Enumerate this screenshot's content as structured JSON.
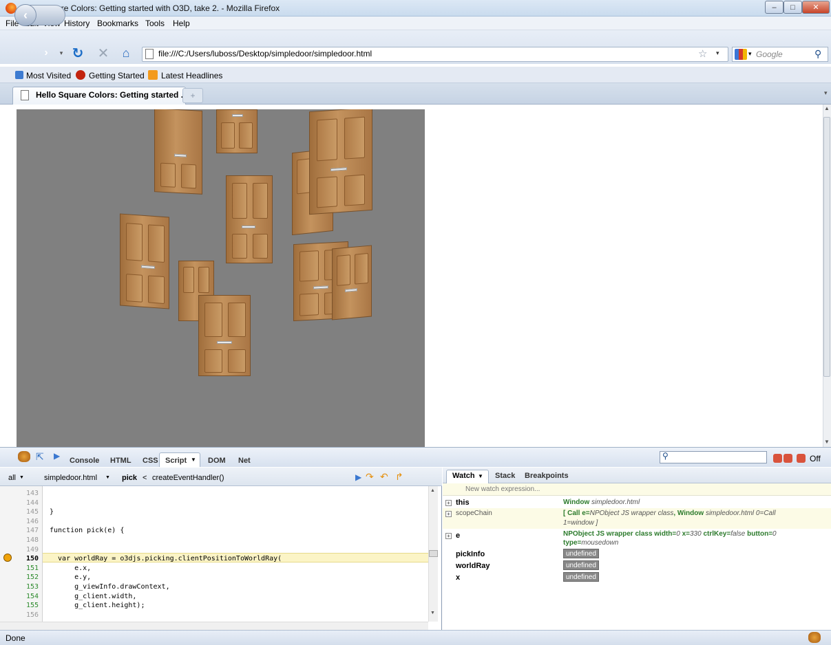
{
  "window": {
    "title": "Hello Square Colors: Getting started with O3D, take 2. - Mozilla Firefox"
  },
  "menu": [
    "File",
    "Edit",
    "View",
    "History",
    "Bookmarks",
    "Tools",
    "Help"
  ],
  "navbar": {
    "url": "file:///C:/Users/luboss/Desktop/simpledoor/simpledoor.html",
    "search_placeholder": "Google"
  },
  "bookmarks": [
    {
      "label": "Most Visited",
      "icon": "globe-icon"
    },
    {
      "label": "Getting Started",
      "icon": "firefox-icon"
    },
    {
      "label": "Latest Headlines",
      "icon": "rss-icon"
    }
  ],
  "tabs": {
    "active_label": "Hello Square Colors: Getting started ...",
    "new_tab_glyph": "+"
  },
  "firebug": {
    "panels": [
      "Console",
      "HTML",
      "CSS",
      "Script",
      "DOM",
      "Net"
    ],
    "active_panel": "Script",
    "off_label": "Off",
    "scriptbar": {
      "scope": "all",
      "file": "simpledoor.html",
      "function": "pick",
      "separator": "<",
      "caller": "createEventHandler()"
    },
    "code_lines": [
      {
        "num": "143",
        "text": "",
        "executable": false
      },
      {
        "num": "144",
        "text": "",
        "executable": false
      },
      {
        "num": "145",
        "text": "}",
        "executable": false
      },
      {
        "num": "146",
        "text": "",
        "executable": false
      },
      {
        "num": "147",
        "text": "function pick(e) {",
        "executable": false
      },
      {
        "num": "148",
        "text": "",
        "executable": false
      },
      {
        "num": "149",
        "text": "",
        "executable": false
      },
      {
        "num": "150",
        "text": "  var worldRay = o3djs.picking.clientPositionToWorldRay(",
        "executable": true,
        "current": true
      },
      {
        "num": "151",
        "text": "      e.x,",
        "executable": true
      },
      {
        "num": "152",
        "text": "      e.y,",
        "executable": true
      },
      {
        "num": "153",
        "text": "      g_viewInfo.drawContext,",
        "executable": true
      },
      {
        "num": "154",
        "text": "      g_client.width,",
        "executable": true
      },
      {
        "num": "155",
        "text": "      g_client.height);",
        "executable": true
      },
      {
        "num": "156",
        "text": "",
        "executable": false
      }
    ],
    "watch": {
      "tabs": [
        "Watch",
        "Stack",
        "Breakpoints"
      ],
      "new_expression": "New watch expression...",
      "rows": [
        {
          "name": "this",
          "value_type": "Window",
          "value_detail": "simpledoor.html"
        },
        {
          "name": "scopeChain",
          "value_line1_a": "[ Call e=",
          "value_line1_b": "NPObject JS wrapper class",
          "value_line1_c": ", Window ",
          "value_line1_d": "simpledoor.html 0=",
          "value_line1_e": "Call",
          "value_line2": "1=window ]"
        },
        {
          "name": "e",
          "value_line1": "NPObject JS wrapper class width=",
          "width": "0",
          "x_label": " x=",
          "x": "330",
          "ctrl_label": " ctrlKey=",
          "ctrl": "false",
          "button_label": " button=",
          "button": "0",
          "type_label": "type=",
          "type": "mousedown"
        },
        {
          "name": "pickInfo",
          "value": "undefined"
        },
        {
          "name": "worldRay",
          "value": "undefined"
        },
        {
          "name": "x",
          "value": "undefined"
        }
      ]
    }
  },
  "status": {
    "text": "Done"
  }
}
